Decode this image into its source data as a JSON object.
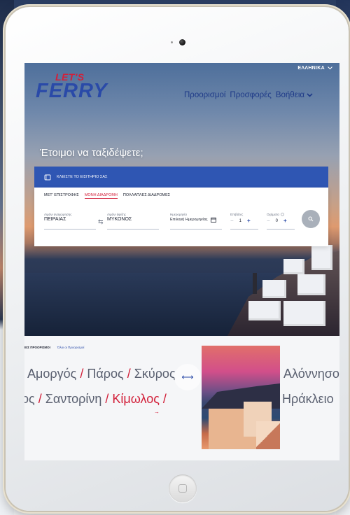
{
  "header": {
    "language": "ΕΛΛΗΝΙΚΑ",
    "logo_top": "LET'S",
    "logo_main": "FERRY",
    "nav": [
      "Προορισμοί",
      "Προσφορές",
      "Βοήθεια"
    ]
  },
  "hero": {
    "title": "Έτοιμοι να ταξιδέψετε;"
  },
  "booking": {
    "header_label": "ΚΛΕΙΣΤΕ ΤΟ ΕΙΣΙΤΗΡΙΟ ΣΑΣ",
    "trip_types": [
      "ΜΕΤ' ΕΠΙΣΤΡΟΦΗΣ",
      "ΜΟΝΗ ΔΙΑΔΡΟΜΗ",
      "ΠΟΛΛΑΠΛΕΣ ΔΙΑΔΡΟΜΕΣ"
    ],
    "active_trip_type": "ΜΟΝΗ ΔΙΑΔΡΟΜΗ",
    "from_label": "Λιμάνι αναχώρησης",
    "from_value": "ΠΕΙΡΑΙΑΣ",
    "to_label": "Λιμάνι άφιξης",
    "to_value": "ΜΥΚΟΝΟΣ",
    "date_label": "Ημερομηνία",
    "date_value": "Επιλογή Ημερομηνίας",
    "passengers_label": "Επιβάτες",
    "passengers_value": "1",
    "vehicles_label": "Οχήματα",
    "vehicles_value": "0"
  },
  "destinations": {
    "header": "ΕΙΣ ΠΡΟΟΡΙΣΜΟΙ",
    "link": "Όλοι οι Προορισμοί",
    "row1": [
      "Αμοργός",
      "Πάρος",
      "Σκύρος"
    ],
    "row1_right": "Αλόννησος",
    "row2_prefix": "ος",
    "row2": [
      "Σαντορίνη",
      "Κίμωλος"
    ],
    "row2_right": "Ηράκλειο",
    "highlighted": "Κίμωλος"
  },
  "colors": {
    "brand_blue": "#2a4aa8",
    "brand_red": "#d2203a",
    "widget_header": "#2f56b3"
  },
  "icons": {
    "language_chevron": "chevron-down-icon",
    "ticket": "ticket-icon",
    "swap": "swap-arrows-icon",
    "calendar": "calendar-icon",
    "info": "info-icon",
    "search": "search-icon",
    "drag": "drag-arrows-icon",
    "home_button": "home-button-icon"
  }
}
